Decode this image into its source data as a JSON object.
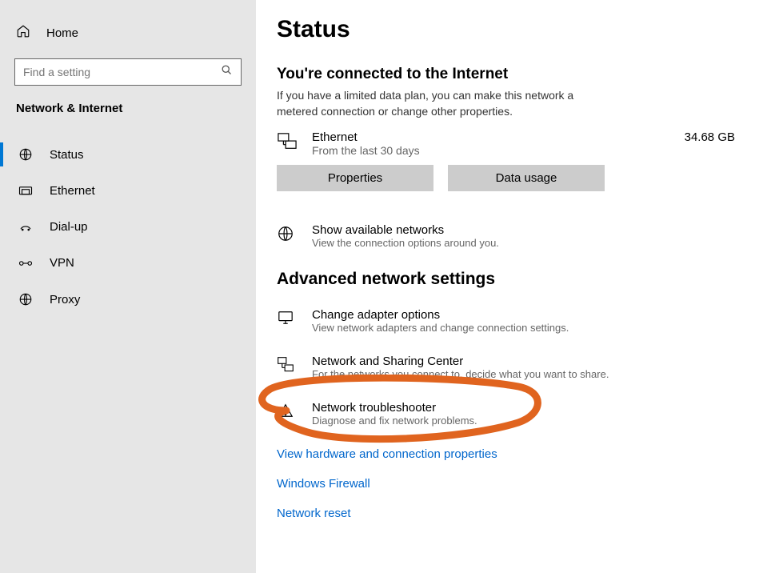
{
  "sidebar": {
    "home": "Home",
    "search_placeholder": "Find a setting",
    "category": "Network & Internet",
    "items": [
      {
        "label": "Status"
      },
      {
        "label": "Ethernet"
      },
      {
        "label": "Dial-up"
      },
      {
        "label": "VPN"
      },
      {
        "label": "Proxy"
      }
    ]
  },
  "main": {
    "title": "Status",
    "connected_heading": "You're connected to the Internet",
    "connected_desc": "If you have a limited data plan, you can make this network a metered connection or change other properties.",
    "conn_name": "Ethernet",
    "conn_sub": "From the last 30 days",
    "conn_usage": "34.68 GB",
    "btn_properties": "Properties",
    "btn_data_usage": "Data usage",
    "show_avail": "Show available networks",
    "show_avail_sub": "View the connection options around you.",
    "adv_heading": "Advanced network settings",
    "adapter": "Change adapter options",
    "adapter_sub": "View network adapters and change connection settings.",
    "sharing": "Network and Sharing Center",
    "sharing_sub": "For the networks you connect to, decide what you want to share.",
    "troubleshoot": "Network troubleshooter",
    "troubleshoot_sub": "Diagnose and fix network problems.",
    "link_hardware": "View hardware and connection properties",
    "link_firewall": "Windows Firewall",
    "link_reset": "Network reset"
  }
}
